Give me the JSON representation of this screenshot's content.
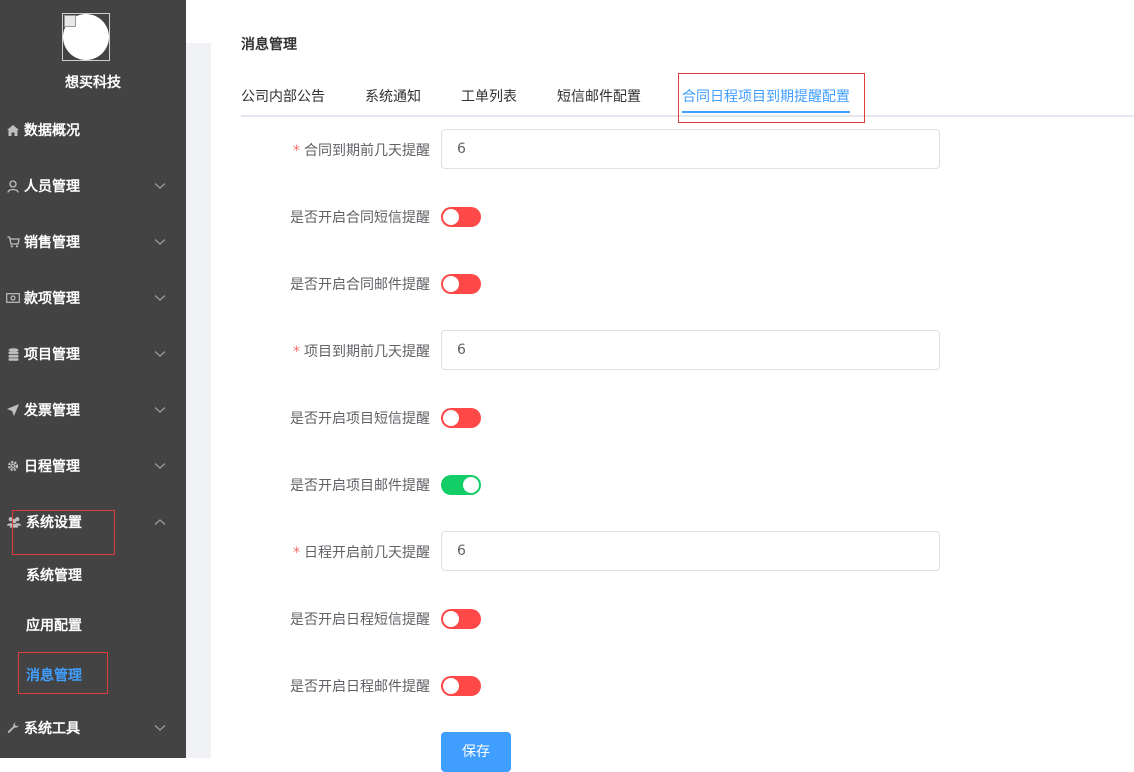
{
  "sidebar": {
    "brand": "想买科技",
    "menu": [
      {
        "label": "数据概况",
        "icon": "home-icon",
        "has_children": false
      },
      {
        "label": "人员管理",
        "icon": "user-icon",
        "has_children": true
      },
      {
        "label": "销售管理",
        "icon": "cart-icon",
        "has_children": true
      },
      {
        "label": "款项管理",
        "icon": "money-icon",
        "has_children": true
      },
      {
        "label": "项目管理",
        "icon": "database-icon",
        "has_children": true
      },
      {
        "label": "发票管理",
        "icon": "send-icon",
        "has_children": true
      },
      {
        "label": "日程管理",
        "icon": "gear-icon",
        "has_children": true
      },
      {
        "label": "系统设置",
        "icon": "users-icon",
        "has_children": true,
        "expanded": true
      },
      {
        "label": "系统工具",
        "icon": "wrench-icon",
        "has_children": true
      }
    ],
    "submenu": [
      {
        "label": "系统管理",
        "active": false
      },
      {
        "label": "应用配置",
        "active": false
      },
      {
        "label": "消息管理",
        "active": true
      }
    ]
  },
  "page": {
    "title": "消息管理"
  },
  "tabs": [
    {
      "label": "公司内部公告",
      "active": false
    },
    {
      "label": "系统通知",
      "active": false
    },
    {
      "label": "工单列表",
      "active": false
    },
    {
      "label": "短信邮件配置",
      "active": false
    },
    {
      "label": "合同日程项目到期提醒配置",
      "active": true
    }
  ],
  "form": {
    "fields": [
      {
        "type": "input",
        "label": "合同到期前几天提醒",
        "required": true,
        "value": "6"
      },
      {
        "type": "switch",
        "label": "是否开启合同短信提醒",
        "checked": false
      },
      {
        "type": "switch",
        "label": "是否开启合同邮件提醒",
        "checked": false
      },
      {
        "type": "input",
        "label": "项目到期前几天提醒",
        "required": true,
        "value": "6"
      },
      {
        "type": "switch",
        "label": "是否开启项目短信提醒",
        "checked": false
      },
      {
        "type": "switch",
        "label": "是否开启项目邮件提醒",
        "checked": true
      },
      {
        "type": "input",
        "label": "日程开启前几天提醒",
        "required": true,
        "value": "6"
      },
      {
        "type": "switch",
        "label": "是否开启日程短信提醒",
        "checked": false
      },
      {
        "type": "switch",
        "label": "是否开启日程邮件提醒",
        "checked": false
      }
    ],
    "required_mark": "*",
    "save_label": "保存"
  },
  "colors": {
    "sidebar_bg": "#434343",
    "accent": "#409eff",
    "switch_off": "#ff4949",
    "switch_on": "#13ce66",
    "highlight_box": "#e03c3c"
  }
}
